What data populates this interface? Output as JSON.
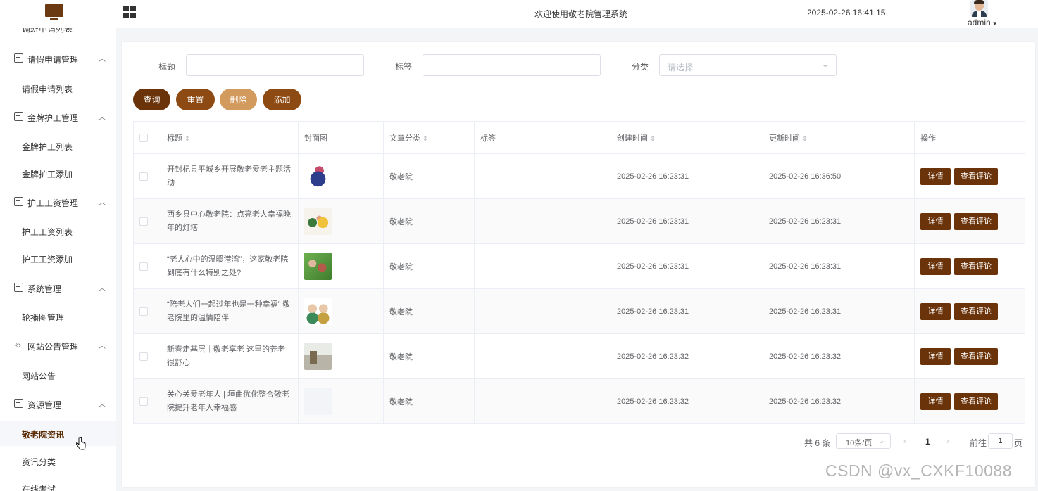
{
  "header": {
    "site_title": "欢迎使用敬老院管理系统",
    "datetime": "2025-02-26 16:41:15",
    "user": "admin",
    "icons": {
      "logo": "monitor-icon",
      "menu": "grid-icon",
      "caret": "caret-down-icon"
    }
  },
  "sidebar": {
    "partial_item": "调班申请列表",
    "groups": [
      {
        "label": "请假申请管理",
        "icon": "form-icon",
        "items": [
          "请假申请列表"
        ]
      },
      {
        "label": "金牌护工管理",
        "icon": "form-icon",
        "items": [
          "金牌护工列表",
          "金牌护工添加"
        ]
      },
      {
        "label": "护工工资管理",
        "icon": "form-icon",
        "items": [
          "护工工资列表",
          "护工工资添加"
        ]
      },
      {
        "label": "系统管理",
        "icon": "folder-icon",
        "items": [
          "轮播图管理"
        ]
      },
      {
        "label": "网站公告管理",
        "icon": "sun-icon",
        "items": [
          "网站公告"
        ]
      },
      {
        "label": "资源管理",
        "icon": "box-icon",
        "items": [
          "敬老院资讯",
          "资讯分类",
          "在线考试"
        ]
      }
    ],
    "active_item": "敬老院资讯"
  },
  "filters": {
    "title_label": "标题",
    "tag_label": "标签",
    "category_label": "分类",
    "category_placeholder": "请选择",
    "title_value": "",
    "tag_value": ""
  },
  "actions": {
    "query": "查询",
    "reset": "重置",
    "delete": "删除",
    "add": "添加"
  },
  "table": {
    "headers": [
      "标题",
      "封面图",
      "文章分类",
      "标签",
      "创建时间",
      "更新时间",
      "操作"
    ],
    "rows": [
      {
        "title": "开封杞县平城乡开展敬老爱老主题活动",
        "category": "敬老院",
        "tag": "",
        "created": "2025-02-26 16:23:31",
        "updated": "2025-02-26 16:36:50"
      },
      {
        "title": "西乡县中心敬老院：点亮老人幸福晚年的灯塔",
        "category": "敬老院",
        "tag": "",
        "created": "2025-02-26 16:23:31",
        "updated": "2025-02-26 16:23:31"
      },
      {
        "title": "“老人心中的温暖港湾”，这家敬老院到底有什么特别之处?",
        "category": "敬老院",
        "tag": "",
        "created": "2025-02-26 16:23:31",
        "updated": "2025-02-26 16:23:31"
      },
      {
        "title": "“陪老人们一起过年也是一种幸福” 敬老院里的温情陪伴",
        "category": "敬老院",
        "tag": "",
        "created": "2025-02-26 16:23:31",
        "updated": "2025-02-26 16:23:31"
      },
      {
        "title": "新春走基层｜敬老享老 这里的养老很舒心",
        "category": "敬老院",
        "tag": "",
        "created": "2025-02-26 16:23:32",
        "updated": "2025-02-26 16:23:32"
      },
      {
        "title": "关心关爱老年人 | 垣曲优化整合敬老院提升老年人幸福感",
        "category": "敬老院",
        "tag": "",
        "created": "2025-02-26 16:23:32",
        "updated": "2025-02-26 16:23:32"
      }
    ],
    "row_actions": {
      "detail": "详情",
      "comments": "查看评论"
    }
  },
  "pagination": {
    "total": "共 6 条",
    "page_size": "10条/页",
    "current": "1",
    "goto_label": "前往",
    "goto_value": "1",
    "unit": "页"
  },
  "watermark": "CSDN @vx_CXKF10088",
  "colors": {
    "primary": "#6b3309",
    "secondary": "#8e4a13",
    "light": "#d39a5e"
  }
}
